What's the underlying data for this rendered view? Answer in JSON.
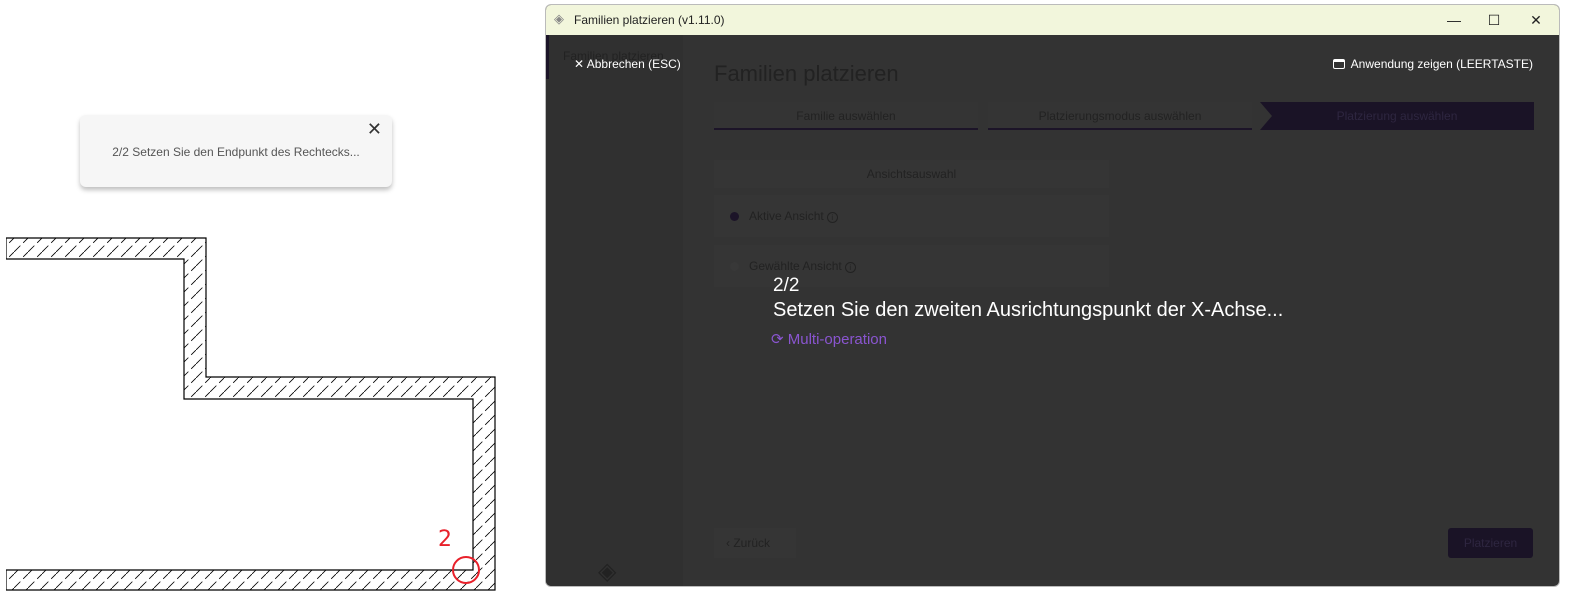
{
  "toast": {
    "message": "2/2 Setzen Sie den Endpunkt des Rechtecks...",
    "close_icon": "close-icon"
  },
  "canvas": {
    "point_label": "2",
    "marker_color": "#e8202a"
  },
  "window": {
    "title": "Familien platzieren (v1.11.0)",
    "controls": {
      "minimize": "—",
      "maximize": "☐",
      "close": "✕"
    },
    "sidebar": {
      "item": "Familien platzieren"
    },
    "cancel": "✕ Abbrechen (ESC)",
    "show_app": "Anwendung zeigen (LEERTASTE)",
    "heading": "Familien platzieren",
    "steps": [
      {
        "label": "Familie auswählen"
      },
      {
        "label": "Platzierungsmodus auswählen"
      },
      {
        "label": "Platzierung auswählen"
      }
    ],
    "view_selection": {
      "header": "Ansichtsauswahl",
      "options": [
        {
          "label": "Aktive Ansicht",
          "selected": true
        },
        {
          "label": "Gewählte Ansicht",
          "selected": false
        }
      ]
    },
    "overlay": {
      "counter": "2/2",
      "instruction": "Setzen Sie den zweiten Ausrichtungspunkt der X-Achse...",
      "mode": "Multi-operation",
      "mode_color": "#8a55d0"
    },
    "back": "Zurück",
    "place": "Platzieren",
    "accent": "#1a1326"
  }
}
